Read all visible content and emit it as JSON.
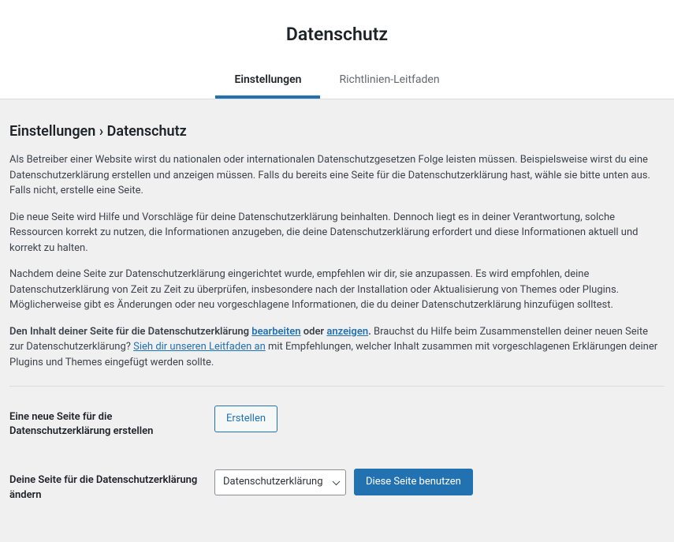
{
  "header": {
    "title": "Datenschutz",
    "tabs": [
      {
        "label": "Einstellungen",
        "active": true
      },
      {
        "label": "Richtlinien-Leitfaden",
        "active": false
      }
    ]
  },
  "section": {
    "title": "Einstellungen › Datenschutz",
    "p1": "Als Betreiber einer Website wirst du nationalen oder internationalen Datenschutzgesetzen Folge leisten müssen. Beispielsweise wirst du eine Datenschutzerklärung erstellen und anzeigen müssen. Falls du bereits eine Seite für die Datenschutzerklärung hast, wähle sie bitte unten aus. Falls nicht, erstelle eine Seite.",
    "p2": "Die neue Seite wird Hilfe und Vorschläge für deine Datenschutzerklärung beinhalten. Dennoch liegt es in deiner Verantwortung, solche Ressourcen korrekt zu nutzen, die Informationen anzugeben, die deine Datenschutzerklärung erfordert und diese Informationen aktuell und korrekt zu halten.",
    "p3": "Nachdem deine Seite zur Datenschutzerklärung eingerichtet wurde, empfehlen wir dir, sie anzupassen. Es wird empfohlen, deine Datenschutzerklärung von Zeit zu Zeit zu überprüfen, insbesondere nach der Installation oder Aktualisierung von Themes oder Plugins. Möglicherweise gibt es Änderungen oder neu vorgeschlagene Informationen, die du deiner Datenschutzerklärung hinzufügen solltest.",
    "p4_strong": "Den Inhalt deiner Seite für die Datenschutzerklärung ",
    "p4_link1": "bearbeiten",
    "p4_mid1": " oder ",
    "p4_link2": "anzeigen",
    "p4_mid2": ". ",
    "p4_after": "Brauchst du Hilfe beim Zusammenstellen deiner neuen Seite zur Datenschutzerklärung? ",
    "p4_link3": "Sieh dir unseren Leitfaden an",
    "p4_end": " mit Empfehlungen, welcher Inhalt zusammen mit vorgeschlagenen Erklärungen deiner Plugins und Themes eingefügt werden sollte."
  },
  "form": {
    "create_label": "Eine neue Seite für die Datenschutzerklärung erstellen",
    "create_button": "Erstellen",
    "change_label": "Deine Seite für die Datenschutzerklärung ändern",
    "select_value": "Datenschutzerklärung",
    "use_button": "Diese Seite benutzen"
  }
}
